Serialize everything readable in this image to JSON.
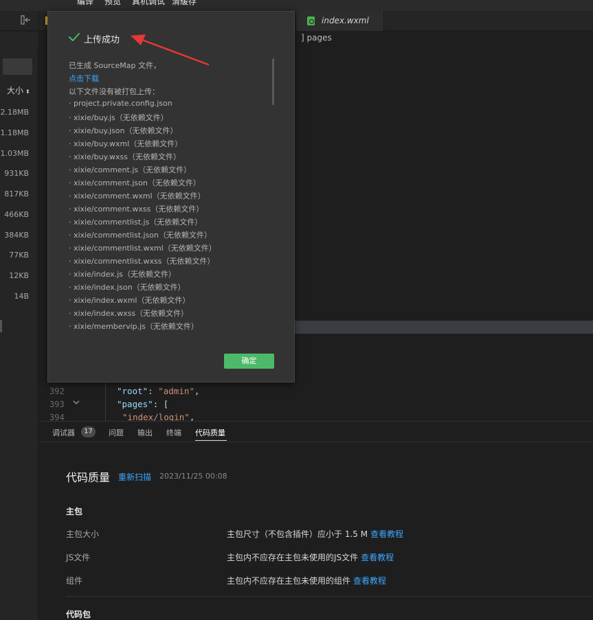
{
  "menu": {
    "items": [
      "编译",
      "预览",
      "真机调试",
      "清缓存"
    ]
  },
  "tabs": {
    "active_file": "index.wxml"
  },
  "breadcrumb": {
    "text": "] pages"
  },
  "left_panel": {
    "size_header": "大小",
    "sort_glyph": "⬍",
    "sizes": [
      "2.18MB",
      "1.18MB",
      "1.03MB",
      "931KB",
      "817KB",
      "466KB",
      "384KB",
      "77KB",
      "12KB",
      "14B"
    ]
  },
  "editor": {
    "line_numbers": [
      "392",
      "393",
      "394"
    ],
    "lines": [
      {
        "key": "\"root\"",
        "sep": ": ",
        "value": "\"admin\"",
        "tail": ","
      },
      {
        "key": "\"pages\"",
        "sep": ": ",
        "value": "",
        "tail": "["
      },
      {
        "key": "",
        "sep": "",
        "value": "\"index/login\"",
        "tail": ","
      }
    ]
  },
  "modal": {
    "title": "上传成功",
    "lines": [
      "已生成 SourceMap 文件，",
      "点击下载",
      "以下文件没有被打包上传：",
      "· project.private.config.json",
      "· xixie/buy.js（无依赖文件）",
      "· xixie/buy.json（无依赖文件）",
      "· xixie/buy.wxml（无依赖文件）",
      "· xixie/buy.wxss（无依赖文件）",
      "· xixie/comment.js（无依赖文件）",
      "· xixie/comment.json（无依赖文件）",
      "· xixie/comment.wxml（无依赖文件）",
      "· xixie/comment.wxss（无依赖文件）",
      "· xixie/commentlist.js（无依赖文件）",
      "· xixie/commentlist.json（无依赖文件）",
      "· xixie/commentlist.wxml（无依赖文件）",
      "· xixie/commentlist.wxss（无依赖文件）",
      "· xixie/index.js（无依赖文件）",
      "· xixie/index.json（无依赖文件）",
      "· xixie/index.wxml（无依赖文件）",
      "· xixie/index.wxss（无依赖文件）",
      "· xixie/membervip.js（无依赖文件）"
    ],
    "confirm_label": "确定"
  },
  "bottom_panel": {
    "tabs": [
      "调试器",
      "问题",
      "输出",
      "终端",
      "代码质量"
    ],
    "debugger_badge": "17",
    "title": "代码质量",
    "rescan": "重新扫描",
    "time": "2023/11/25 00:08",
    "sections": [
      {
        "title": "主包",
        "rows": [
          {
            "label": "主包大小",
            "desc": "主包尺寸（不包含插件）应小于 1.5 M",
            "link": "查看教程"
          },
          {
            "label": "JS文件",
            "desc": "主包内不应存在主包未使用的JS文件",
            "link": "查看教程"
          },
          {
            "label": "组件",
            "desc": "主包内不应存在主包未使用的组件",
            "link": "查看教程"
          }
        ]
      },
      {
        "title": "代码包",
        "rows": []
      }
    ]
  },
  "colors": {
    "accent_link": "#3ea6ff",
    "success_green": "#4dba6b",
    "annotation_red": "#e53935"
  }
}
